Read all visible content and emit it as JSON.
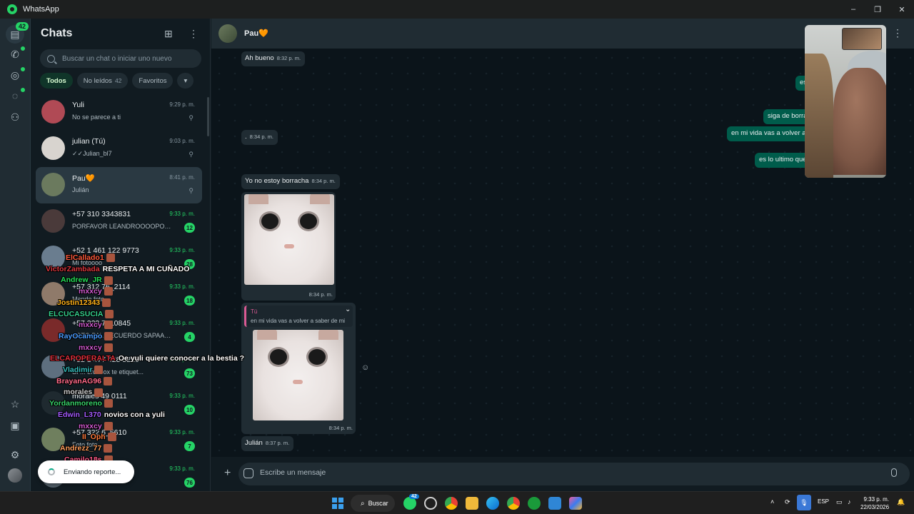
{
  "window": {
    "title": "WhatsApp",
    "controls": [
      "–",
      "❐",
      "✕"
    ]
  },
  "rail": {
    "chats_badge": "42"
  },
  "chat_list": {
    "title": "Chats",
    "search_placeholder": "Buscar un chat o iniciar uno nuevo",
    "filters": [
      {
        "label": "Todos",
        "count": ""
      },
      {
        "label": "No leídos",
        "count": "42"
      },
      {
        "label": "Favoritos",
        "count": ""
      },
      {
        "label": "▾",
        "count": ""
      }
    ],
    "items": [
      {
        "name": "Yuli",
        "preview": "No se parece a ti",
        "time": "9:29 p. m.",
        "unread": "",
        "pinned": true,
        "avatar_color": "#b04a55"
      },
      {
        "name": "julian (Tú)",
        "preview": "✓✓Julian_bl7",
        "time": "9:03 p. m.",
        "unread": "",
        "pinned": true,
        "avatar_color": "#d8d4cf"
      },
      {
        "name": "Pau🧡",
        "preview": "Julián",
        "time": "8:41 p. m.",
        "unread": "",
        "pinned": true,
        "avatar_color": "#6b7a5e"
      },
      {
        "name": "+57 310 3343831",
        "preview": "PORFAVOR LEANDROOOOPOR...",
        "time": "9:33 p. m.",
        "unread": "12",
        "pinned": false,
        "avatar_color": "#4a3a3a"
      },
      {
        "name": "+52 1 461 122 9773",
        "preview": "Mi fotoooo",
        "time": "9:33 p. m.",
        "unread": "28",
        "pinned": false,
        "avatar_color": "#6a7d8f"
      },
      {
        "name": "+57 312 76_2114",
        "preview": "Mande foto",
        "time": "9:33 p. m.",
        "unread": "18",
        "pinned": false,
        "avatar_color": "#8f7a6a"
      },
      {
        "name": "+57 322 7610845",
        "preview": "FOTO PAL RECUERDO SAPAAAA, M...",
        "time": "9:33 p. m.",
        "unread": "4",
        "pinned": false,
        "avatar_color": "#7a2a2a"
      },
      {
        "name": "+52 1 477 428 5210",
        "preview": "Sí ... erchoox te etiquet...",
        "time": "9:33 p. m.",
        "unread": "73",
        "pinned": false,
        "avatar_color": "#5e6f7f"
      },
      {
        "name": "morales 49 0111",
        "preview": "",
        "time": "9:33 p. m.",
        "unread": "10",
        "pinned": false,
        "avatar_color": "#1f2a30"
      },
      {
        "name": "+57 322 6_5610",
        "preview": "Foto foto",
        "time": "9:33 p. m.",
        "unread": "7",
        "pinned": false,
        "avatar_color": "#6f7f5e"
      },
      {
        "name": "",
        "preview": "",
        "time": "9:33 p. m.",
        "unread": "76",
        "pinned": false,
        "avatar_color": "#53606a"
      }
    ]
  },
  "toast": {
    "text": "Enviando reporte..."
  },
  "stream_chat": [
    {
      "user": "ElCallado1",
      "color": "#ff5a3c",
      "msg": ""
    },
    {
      "user": "VictorZambada",
      "color": "#d9363e",
      "msg": "RESPETA A MI CUÑADO"
    },
    {
      "user": "Andrew_JR",
      "color": "#25e05a",
      "msg": ""
    },
    {
      "user": "mxxcy",
      "color": "#d05ad0",
      "msg": ""
    },
    {
      "user": "Jostin12343",
      "color": "#ffb21a",
      "msg": ""
    },
    {
      "user": "ELCUCASUCIA",
      "color": "#35d08e",
      "msg": ""
    },
    {
      "user": "mxxcy",
      "color": "#d05ad0",
      "msg": ""
    },
    {
      "user": "RayOcampo",
      "color": "#4a9cff",
      "msg": ""
    },
    {
      "user": "mxxcy",
      "color": "#d05ad0",
      "msg": ""
    },
    {
      "user": "ELCAPOPERALTA",
      "color": "#e0303c",
      "msg": "Oe yuli quiere conocer a la bestia ?"
    },
    {
      "user": "Vladimir",
      "color": "#35c0c0",
      "msg": ""
    },
    {
      "user": "BrayanAG96",
      "color": "#ff6b8a",
      "msg": ""
    },
    {
      "user": "morales",
      "color": "#c9c9c9",
      "msg": ""
    },
    {
      "user": "Yordanmoreno",
      "color": "#37d46b",
      "msg": ""
    },
    {
      "user": "Edwin_L370",
      "color": "#a45cff",
      "msg": "novios con a yuli"
    },
    {
      "user": "mxxcy",
      "color": "#d05ad0",
      "msg": ""
    },
    {
      "user": "II_Oph",
      "color": "#ff7a3c",
      "msg": ""
    },
    {
      "user": "Andrezz_77",
      "color": "#ff9d5c",
      "msg": ""
    },
    {
      "user": "Camilo18s",
      "color": "#ff5a8a",
      "msg": ""
    }
  ],
  "conversation": {
    "contact": "Pau🧡",
    "messages": [
      {
        "text": "Ah bueno",
        "time": "8:32 p. m.",
        "dir": "in"
      },
      {
        "text": "es",
        "time": "",
        "dir": "out"
      },
      {
        "text": "siga de borra",
        "time": "",
        "dir": "out"
      },
      {
        "text": "en mi vida vas a volver a",
        "time": "",
        "dir": "out"
      },
      {
        "text": "",
        "time": "8:34 p. m.",
        "dir": "in"
      },
      {
        "text": "es lo ultimo que",
        "time": "",
        "dir": "out"
      },
      {
        "text": "Yo no estoy borracha",
        "time": "8:34 p. m.",
        "dir": "in"
      },
      {
        "text": "",
        "time": "8:34 p. m.",
        "dir": "in",
        "image": "cat-sticker"
      },
      {
        "text": "",
        "time": "8:34 p. m.",
        "dir": "in",
        "image": "cat-sticker",
        "quote_author": "Tú",
        "quote_text": "en mi vida vas a volver a saber de mi"
      },
      {
        "text": "Julián",
        "time": "8:37 p. m.",
        "dir": "in"
      }
    ],
    "composer_placeholder": "Escribe un mensaje"
  },
  "taskbar": {
    "search_label": "Buscar",
    "whatsapp_badge": "42",
    "tray_lang": "ESP",
    "time": "9:33 p. m.",
    "date": "22/03/2026"
  }
}
